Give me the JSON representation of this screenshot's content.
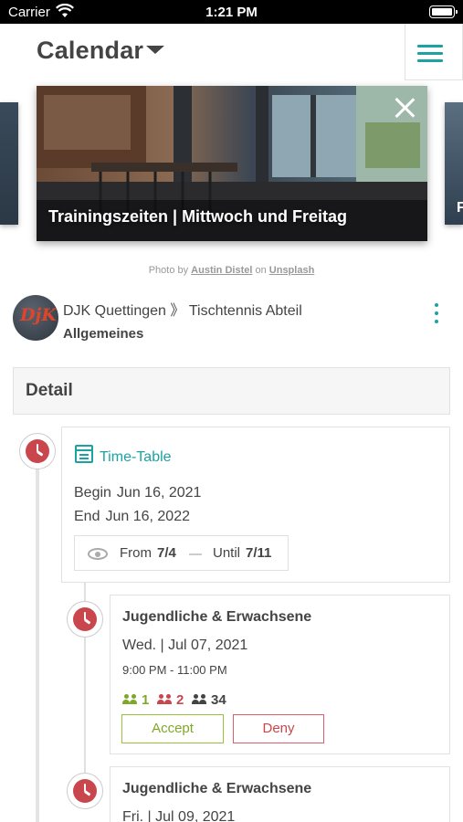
{
  "status_bar": {
    "carrier": "Carrier",
    "time": "1:21 PM"
  },
  "header": {
    "title": "Calendar"
  },
  "hero": {
    "caption": "Trainingszeiten | Mittwoch und Freitag",
    "side_right_letter": "F",
    "credit": {
      "prefix": "Photo by",
      "author": "Austin Distel",
      "middle": "on",
      "site": "Unsplash"
    }
  },
  "org": {
    "avatar_text": "DjK",
    "path": "DJK Quettingen 》 Tischtennis Abteil",
    "group": "Allgemeines"
  },
  "section": {
    "title": "Detail"
  },
  "timetable": {
    "label": "Time-Table",
    "begin_label": "Begin",
    "begin_value": "Jun 16, 2021",
    "end_label": "End",
    "end_value": "Jun 16, 2022",
    "from_label": "From",
    "from_value": "7/4",
    "until_label": "Until",
    "until_value": "7/11"
  },
  "events": [
    {
      "title": "Jugendliche & Erwachsene",
      "date": "Wed. | Jul 07, 2021",
      "time": "9:00 PM - 11:00 PM",
      "accepted": "1",
      "declined": "2",
      "total": "34",
      "accept_label": "Accept",
      "deny_label": "Deny"
    },
    {
      "title": "Jugendliche & Erwachsene",
      "date": "Fri. | Jul 09, 2021"
    }
  ],
  "colors": {
    "accent": "#1ba3a3",
    "clock": "#c9464d",
    "accept": "#7fa82a",
    "deny": "#c9464d",
    "total": "#444444"
  },
  "icons": [
    "wifi-icon",
    "battery-icon",
    "chevron-down-icon",
    "hamburger-menu-icon",
    "close-icon",
    "clock-icon",
    "calendar-icon",
    "eye-icon",
    "people-icon",
    "more-vertical-icon"
  ]
}
